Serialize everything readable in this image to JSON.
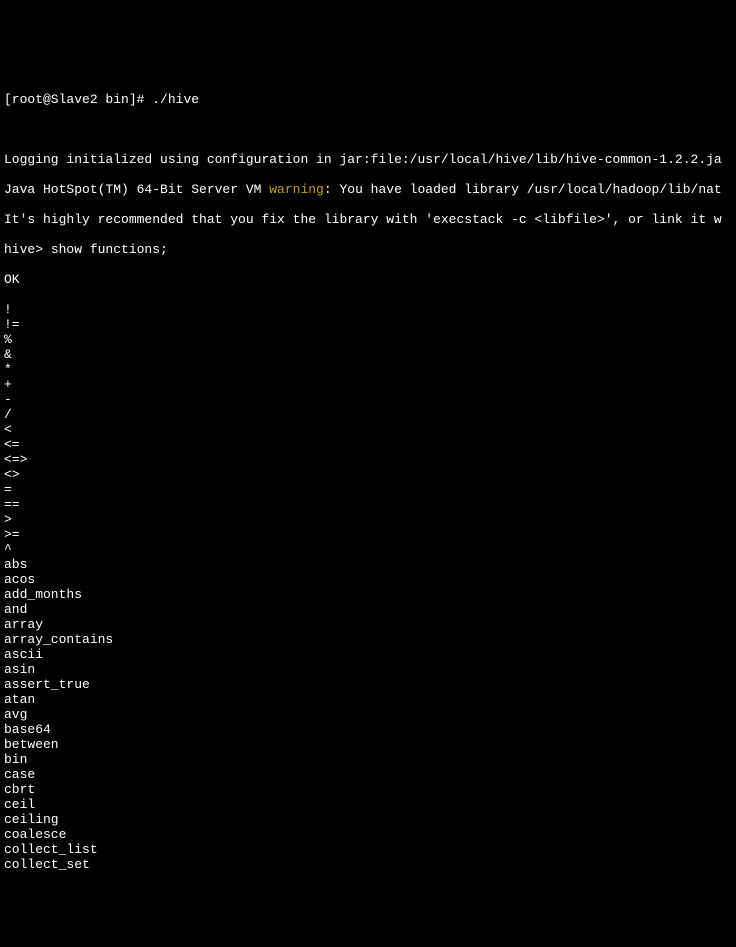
{
  "terminal": {
    "top_fragment": "",
    "prompt_prefix": "[root@Slave2 bin]# ",
    "command": "./hive",
    "blank1": "",
    "log_line": "Logging initialized using configuration in jar:file:/usr/local/hive/lib/hive-common-1.2.2.ja",
    "hotspot_prefix": "Java HotSpot(TM) 64-Bit Server VM ",
    "hotspot_warning": "warning",
    "hotspot_suffix": ": You have loaded library /usr/local/hadoop/lib/nat",
    "recommend_line": "It's highly recommended that you fix the library with 'execstack -c <libfile>', or link it w",
    "hive_prompt": "hive> ",
    "hive_command": "show functions;",
    "ok": "OK",
    "functions": [
      "!",
      "!=",
      "%",
      "&",
      "*",
      "+",
      "-",
      "/",
      "<",
      "<=",
      "<=>",
      "<>",
      "=",
      "==",
      ">",
      ">=",
      "^",
      "abs",
      "acos",
      "add_months",
      "and",
      "array",
      "array_contains",
      "ascii",
      "asin",
      "assert_true",
      "atan",
      "avg",
      "base64",
      "between",
      "bin",
      "case",
      "cbrt",
      "ceil",
      "ceiling",
      "coalesce",
      "collect_list",
      "collect_set"
    ]
  }
}
